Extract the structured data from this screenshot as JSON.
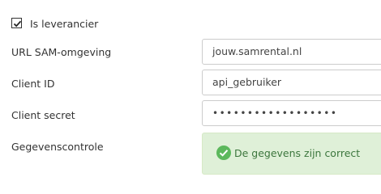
{
  "supplier": {
    "checked": true,
    "label": "Is leverancier"
  },
  "fields": {
    "url": {
      "label": "URL SAM-omgeving",
      "value": "jouw.samrental.nl"
    },
    "client_id": {
      "label": "Client ID",
      "value": "api_gebruiker"
    },
    "client_secret": {
      "label": "Client secret",
      "value": "••••••••••••••••••"
    }
  },
  "validation": {
    "label": "Gegevenscontrole",
    "message": "De gegevens zijn correct",
    "icon": "check-circle-icon",
    "color": "#5cb85c"
  }
}
